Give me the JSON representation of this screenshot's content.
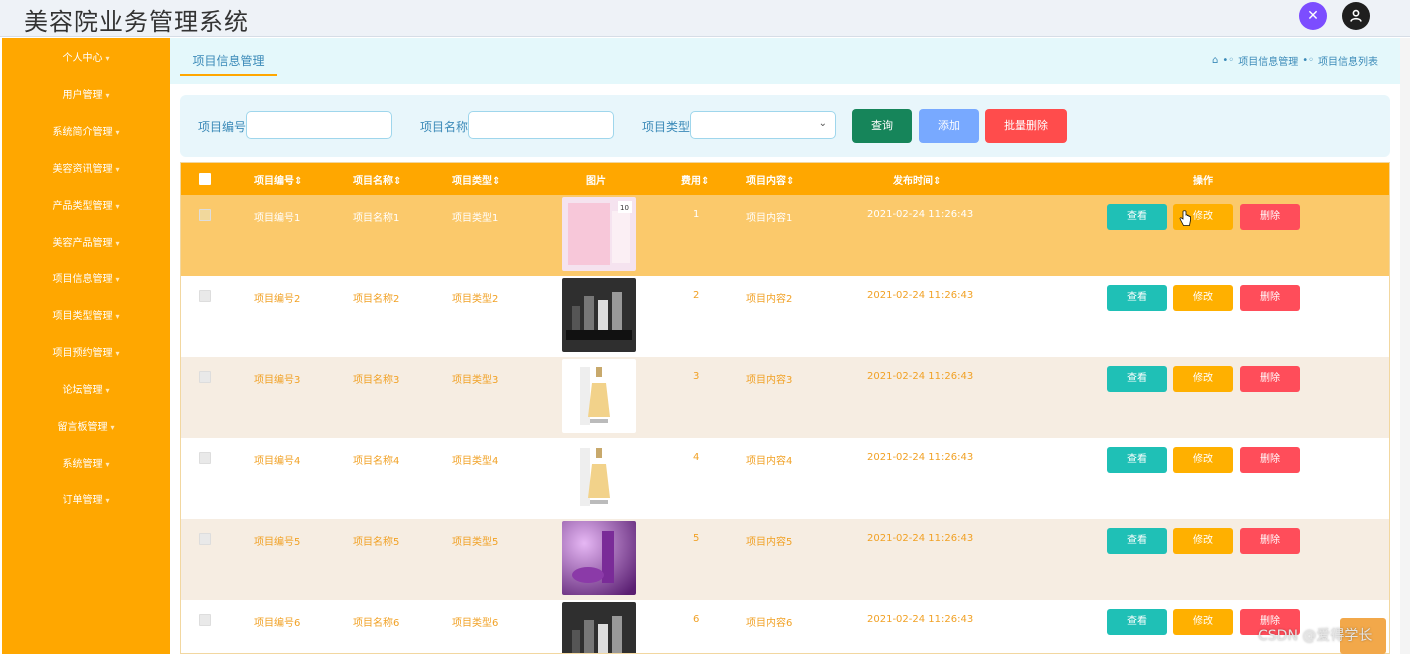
{
  "app": {
    "title": "美容院业务管理系统"
  },
  "top_icons": [
    "expand-icon",
    "user-icon"
  ],
  "colors": {
    "sidebar": "#ffa700",
    "header": "#ffa700",
    "query": "#16855a",
    "add": "#78a9ff",
    "delete": "#ff4c4c",
    "view": "#1fc0b6",
    "edit": "#ffb000"
  },
  "sidebar": {
    "items": [
      {
        "label": "个人中心"
      },
      {
        "label": "用户管理"
      },
      {
        "label": "系统简介管理"
      },
      {
        "label": "美容资讯管理"
      },
      {
        "label": "产品类型管理"
      },
      {
        "label": "美容产品管理"
      },
      {
        "label": "项目信息管理"
      },
      {
        "label": "项目类型管理"
      },
      {
        "label": "项目预约管理"
      },
      {
        "label": "论坛管理"
      },
      {
        "label": "留言板管理"
      },
      {
        "label": "系统管理"
      },
      {
        "label": "订单管理"
      }
    ]
  },
  "tabs": {
    "active": "项目信息管理"
  },
  "breadcrumb": {
    "level1": "项目信息管理",
    "level2": "项目信息列表"
  },
  "search": {
    "label_number": "项目编号",
    "label_name": "项目名称",
    "label_type": "项目类型",
    "query_label": "查询",
    "add_label": "添加",
    "batch_delete_label": "批量删除"
  },
  "table": {
    "headers": [
      "项目编号",
      "项目名称",
      "项目类型",
      "图片",
      "费用",
      "项目内容",
      "发布时间",
      "操作"
    ],
    "rows": [
      {
        "no": "项目编号1",
        "name": "项目名称1",
        "type": "项目类型1",
        "fee": "1",
        "content": "项目内容1",
        "time": "2021-02-24 11:26:43"
      },
      {
        "no": "项目编号2",
        "name": "项目名称2",
        "type": "项目类型2",
        "fee": "2",
        "content": "项目内容2",
        "time": "2021-02-24 11:26:43"
      },
      {
        "no": "项目编号3",
        "name": "项目名称3",
        "type": "项目类型3",
        "fee": "3",
        "content": "项目内容3",
        "time": "2021-02-24 11:26:43"
      },
      {
        "no": "项目编号4",
        "name": "项目名称4",
        "type": "项目类型4",
        "fee": "4",
        "content": "项目内容4",
        "time": "2021-02-24 11:26:43"
      },
      {
        "no": "项目编号5",
        "name": "项目名称5",
        "type": "项目类型5",
        "fee": "5",
        "content": "项目内容5",
        "time": "2021-02-24 11:26:43"
      },
      {
        "no": "项目编号6",
        "name": "项目名称6",
        "type": "项目类型6",
        "fee": "6",
        "content": "项目内容6",
        "time": "2021-02-24 11:26:43"
      }
    ],
    "actions": {
      "view": "查看",
      "edit": "修改",
      "delete": "删除"
    }
  },
  "watermark": "CSDN @爱得学长"
}
